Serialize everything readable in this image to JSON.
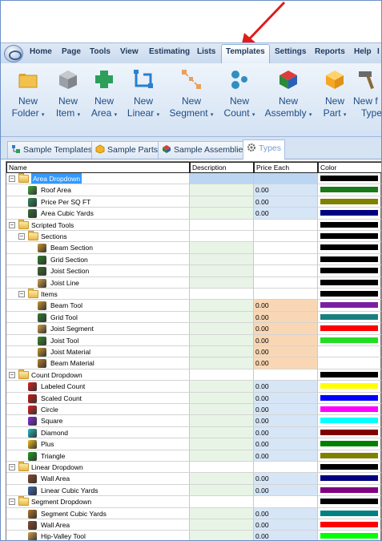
{
  "ribbon_tabs": [
    "Home",
    "Page",
    "Tools",
    "View",
    "Estimating",
    "Lists",
    "Templates",
    "Settings",
    "Reports",
    "Help",
    "I"
  ],
  "active_tab": "Templates",
  "ribbon_buttons": [
    {
      "l1": "New",
      "l2": "Folder",
      "icon": "folder-icon"
    },
    {
      "l1": "New",
      "l2": "Item",
      "icon": "item-cube-icon"
    },
    {
      "l1": "New",
      "l2": "Area",
      "icon": "area-shape-icon"
    },
    {
      "l1": "New",
      "l2": "Linear",
      "icon": "linear-icon"
    },
    {
      "l1": "New",
      "l2": "Segment",
      "icon": "segment-icon"
    },
    {
      "l1": "New",
      "l2": "Count",
      "icon": "count-dots-icon"
    },
    {
      "l1": "New",
      "l2": "Assembly",
      "icon": "assembly-cube-icon"
    },
    {
      "l1": "New",
      "l2": "Part",
      "icon": "part-cube-icon"
    },
    {
      "l1": "New f",
      "l2": "Type",
      "icon": "hammer-icon"
    }
  ],
  "doc_tabs": [
    {
      "label": "Sample Templates",
      "icon": "templates-icon"
    },
    {
      "label": "Sample Parts",
      "icon": "parts-icon"
    },
    {
      "label": "Sample Assemblies",
      "icon": "assemblies-icon"
    },
    {
      "label": "Types",
      "icon": "types-gear-icon"
    }
  ],
  "grid": {
    "headers": {
      "name": "Name",
      "description": "Description",
      "price": "Price Each",
      "color": "Color"
    },
    "rows": [
      {
        "level": 0,
        "kind": "folder",
        "expander": "−",
        "name": "Area Dropdown",
        "desc": "",
        "price": "",
        "color": "#000000",
        "selected": true
      },
      {
        "level": 1,
        "kind": "item",
        "icon_color": "#49a83b",
        "name": "Roof Area",
        "desc": "",
        "price": "0.00",
        "color": "#1a7a1a"
      },
      {
        "level": 1,
        "kind": "item",
        "icon_color": "#2e8b57",
        "name": "Price Per SQ FT",
        "desc": "",
        "price": "0.00",
        "color": "#808000"
      },
      {
        "level": 1,
        "kind": "item",
        "icon_color": "#2f6e2f",
        "name": "Area Cubic Yards",
        "desc": "",
        "price": "0.00",
        "color": "#000080"
      },
      {
        "level": 0,
        "kind": "folder",
        "expander": "−",
        "name": "Scripted Tools",
        "desc": "",
        "price": "",
        "color": "#000000"
      },
      {
        "level": 1,
        "kind": "folder",
        "expander": "−",
        "name": "Sections",
        "desc": "",
        "price": "",
        "color": "#000000"
      },
      {
        "level": 2,
        "kind": "item",
        "icon_color": "#c8962e",
        "name": "Beam Section",
        "desc": "",
        "price": "",
        "color": "#000000"
      },
      {
        "level": 2,
        "kind": "item",
        "icon_color": "#2e7d2e",
        "name": "Grid Section",
        "desc": "",
        "price": "",
        "color": "#000000"
      },
      {
        "level": 2,
        "kind": "item",
        "icon_color": "#3a6b2a",
        "name": "Joist Section",
        "desc": "",
        "price": "",
        "color": "#000000"
      },
      {
        "level": 2,
        "kind": "item",
        "icon_color": "#d4a04a",
        "name": "Joist Line",
        "desc": "",
        "price": "",
        "color": "#000000"
      },
      {
        "level": 1,
        "kind": "folder",
        "expander": "−",
        "name": "Items",
        "desc": "",
        "price": "",
        "color": "#000000"
      },
      {
        "level": 2,
        "kind": "item",
        "icon_color": "#c8962e",
        "name": "Beam Tool",
        "desc": "",
        "price": "0.00",
        "color": "#7b1fa2",
        "price_bg": "#f9d7b5"
      },
      {
        "level": 2,
        "kind": "item",
        "icon_color": "#2e7d2e",
        "name": "Grid Tool",
        "desc": "",
        "price": "0.00",
        "color": "#1b7f7f",
        "price_bg": "#f9d7b5"
      },
      {
        "level": 2,
        "kind": "item",
        "icon_color": "#d4a04a",
        "name": "Joist Segment",
        "desc": "",
        "price": "0.00",
        "color": "#ff0000",
        "price_bg": "#f9d7b5"
      },
      {
        "level": 2,
        "kind": "item",
        "icon_color": "#3a8a2a",
        "name": "Joist Tool",
        "desc": "",
        "price": "0.00",
        "color": "#22dd22",
        "price_bg": "#f9d7b5"
      },
      {
        "level": 2,
        "kind": "item",
        "icon_color": "#c8962e",
        "name": "Joist Material",
        "desc": "",
        "price": "0.00",
        "color": "#ffffff",
        "price_bg": "#f9d7b5"
      },
      {
        "level": 2,
        "kind": "item",
        "icon_color": "#b87e2a",
        "name": "Beam Material",
        "desc": "",
        "price": "0.00",
        "color": "#ffffff",
        "price_bg": "#f9d7b5"
      },
      {
        "level": 0,
        "kind": "folder",
        "expander": "−",
        "name": "Count Dropdown",
        "desc": "",
        "price": "",
        "color": "#000000"
      },
      {
        "level": 1,
        "kind": "item",
        "icon_color": "#e02020",
        "name": "Labeled Count",
        "desc": "",
        "price": "0.00",
        "color": "#ffff00"
      },
      {
        "level": 1,
        "kind": "item",
        "icon_color": "#d01818",
        "name": "Scaled Count",
        "desc": "",
        "price": "0.00",
        "color": "#0000ff"
      },
      {
        "level": 1,
        "kind": "item",
        "icon_color": "#e02020",
        "name": "Circle",
        "desc": "",
        "price": "0.00",
        "color": "#ff00ff"
      },
      {
        "level": 1,
        "kind": "item",
        "icon_color": "#8a2be2",
        "name": "Square",
        "desc": "",
        "price": "0.00",
        "color": "#00ffff"
      },
      {
        "level": 1,
        "kind": "item",
        "icon_color": "#20c0c0",
        "name": "Diamond",
        "desc": "",
        "price": "0.00",
        "color": "#800000"
      },
      {
        "level": 1,
        "kind": "item",
        "icon_color": "#f0c020",
        "name": "Plus",
        "desc": "",
        "price": "0.00",
        "color": "#008000"
      },
      {
        "level": 1,
        "kind": "item",
        "icon_color": "#20a020",
        "name": "Triangle",
        "desc": "",
        "price": "0.00",
        "color": "#808000"
      },
      {
        "level": 0,
        "kind": "folder",
        "expander": "−",
        "name": "Linear Dropdown",
        "desc": "",
        "price": "",
        "color": "#000000"
      },
      {
        "level": 1,
        "kind": "item",
        "icon_color": "#8a4a2a",
        "name": "Wall Area",
        "desc": "",
        "price": "0.00",
        "color": "#000080"
      },
      {
        "level": 1,
        "kind": "item",
        "icon_color": "#3a6ab0",
        "name": "Linear Cubic Yards",
        "desc": "",
        "price": "0.00",
        "color": "#800080"
      },
      {
        "level": 0,
        "kind": "folder",
        "expander": "−",
        "name": "Segment Dropdown",
        "desc": "",
        "price": "",
        "color": "#000000"
      },
      {
        "level": 1,
        "kind": "item",
        "icon_color": "#b8742a",
        "name": "Segment Cubic Yards",
        "desc": "",
        "price": "0.00",
        "color": "#008080"
      },
      {
        "level": 1,
        "kind": "item",
        "icon_color": "#8a4a2a",
        "name": "Wall Area",
        "desc": "",
        "price": "0.00",
        "color": "#ff0000"
      },
      {
        "level": 1,
        "kind": "item",
        "icon_color": "#d4a04a",
        "name": "Hip-Valley Tool",
        "desc": "",
        "price": "0.00",
        "color": "#00ff00"
      }
    ]
  }
}
